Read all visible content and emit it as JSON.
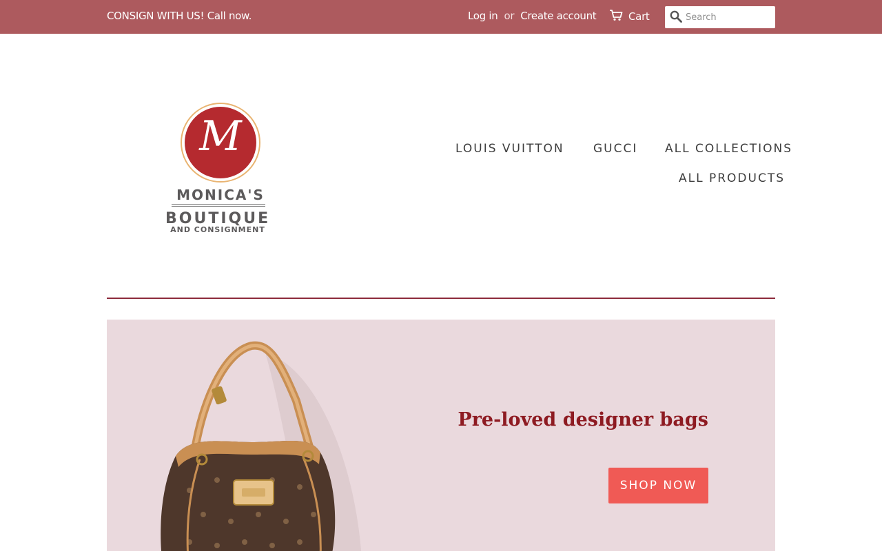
{
  "topbar": {
    "announcement": "CONSIGN WITH US! Call now.",
    "login": "Log in",
    "or": "or",
    "create_account": "Create account",
    "cart": "Cart",
    "cart_icon": "cart-icon",
    "search_icon": "search-icon",
    "search_placeholder": "Search",
    "background": "#ad5a5e"
  },
  "logo": {
    "monogram": "M",
    "line1": "MONICA'S",
    "line2": "BOUTIQUE",
    "line3": "AND CONSIGNMENT"
  },
  "nav": {
    "items": [
      {
        "label": "LOUIS VUITTON"
      },
      {
        "label": "GUCCI"
      },
      {
        "label": "ALL COLLECTIONS"
      },
      {
        "label": "ALL PRODUCTS"
      }
    ]
  },
  "hero": {
    "headline": "Pre-loved designer bags",
    "button": "SHOP NOW",
    "background": "#ead9dd",
    "accent": "#f05a55",
    "headline_color": "#8e1b22"
  }
}
